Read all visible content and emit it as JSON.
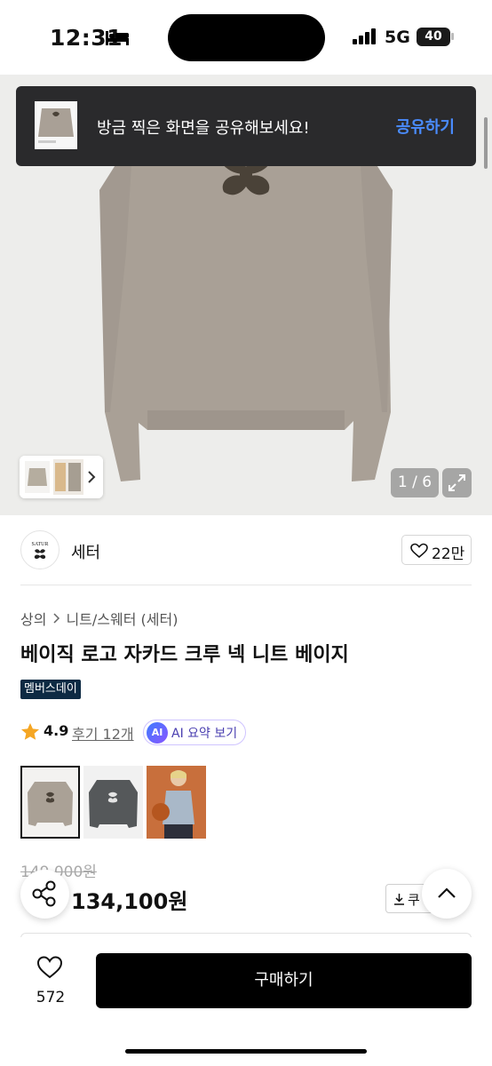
{
  "status_bar": {
    "time": "12:31",
    "network": "5G",
    "battery": "40"
  },
  "toast": {
    "message": "방금 찍은 화면을 공유해보세요!",
    "action": "공유하기"
  },
  "gallery": {
    "counter": "1 / 6"
  },
  "brand": {
    "name": "세터",
    "logo_text": "SATUR",
    "likes": "22만"
  },
  "breadcrumb": [
    "상의",
    "니트/스웨터 (세터)"
  ],
  "product": {
    "title": "베이직 로고 자카드 크루 넥 니트 베이지",
    "badge": "멤버스데이",
    "rating": "4.9",
    "reviews": "후기 12개",
    "ai_icon": "AI",
    "ai_summary": "AI 요약 보기",
    "original_price": "149,000원",
    "sale_price": "134,100원",
    "coupon_label": "쿠"
  },
  "bottom_bar": {
    "wish_count": "572",
    "buy_label": "구매하기"
  },
  "colors": {
    "accent_blue": "#4a8cff",
    "badge_navy": "#0d2a43",
    "star": "#f5a623",
    "sweater_beige": "#a9a096"
  }
}
